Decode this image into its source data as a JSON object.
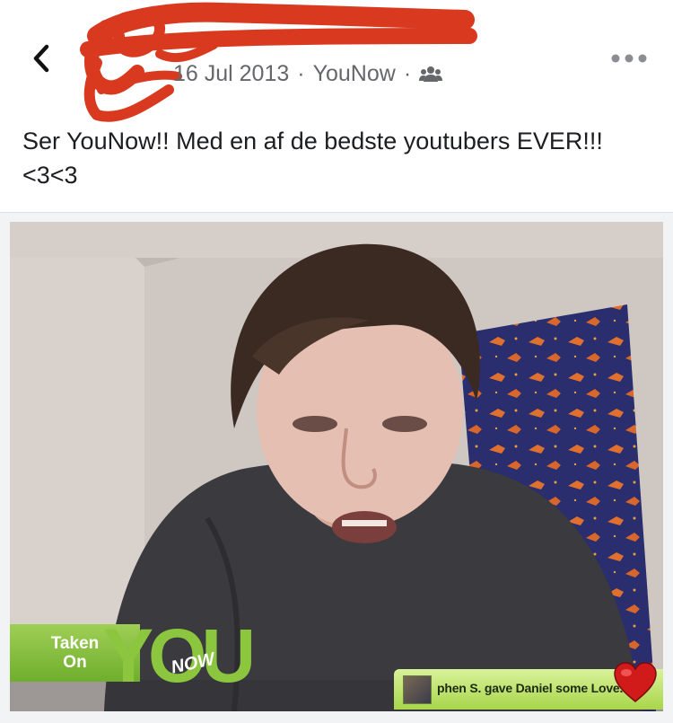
{
  "post": {
    "date": "16 Jul 2013",
    "separator": "·",
    "source": "YouNow",
    "audience_icon": "friends-icon",
    "text": "Ser YouNow!! Med en af de bedste youtubers EVER!!! <3<3"
  },
  "photo": {
    "overlay": {
      "taken_line1": "Taken",
      "taken_line2": "On",
      "logo_you": "YOU",
      "logo_now": "NOW",
      "love_message": "phen S. gave Daniel some Love."
    }
  },
  "colors": {
    "meta_gray": "#65676b",
    "redaction": "#d8391f",
    "younow_green": "#8cc63f"
  }
}
